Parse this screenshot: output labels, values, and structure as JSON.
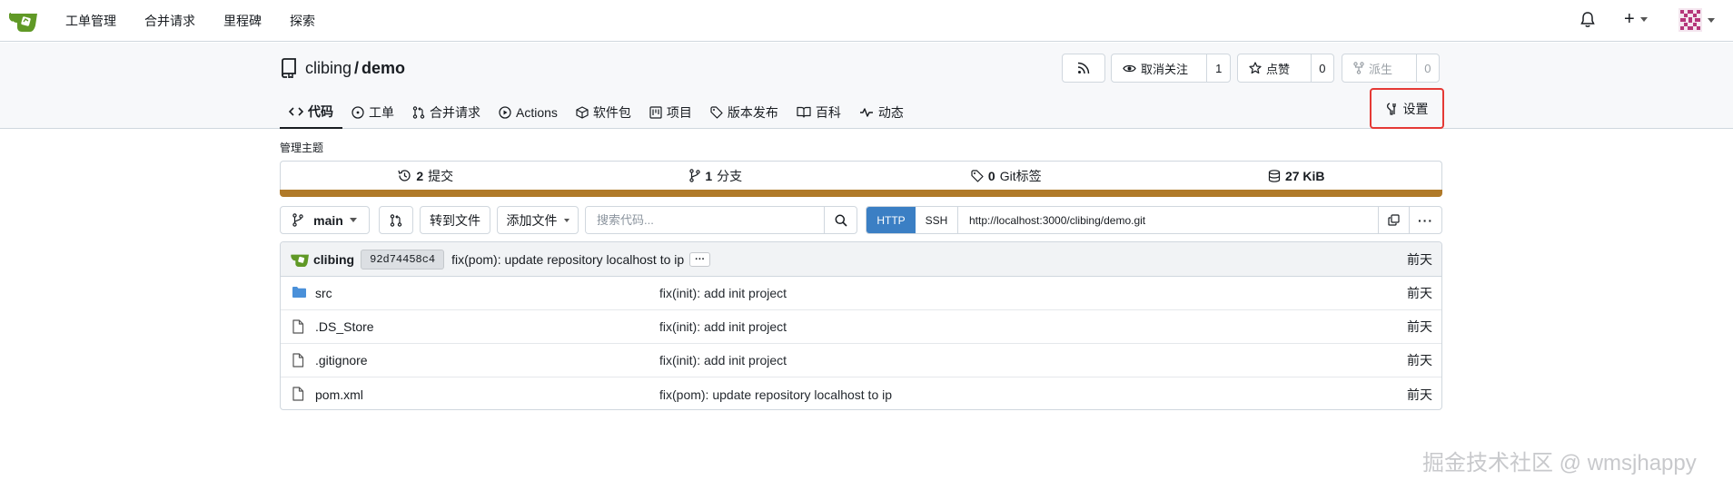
{
  "navbar": {
    "items": [
      "工单管理",
      "合并请求",
      "里程碑",
      "探索"
    ],
    "add_label": "+"
  },
  "repo": {
    "owner": "clibing",
    "separator": "/",
    "name": "demo",
    "unwatch_label": "取消关注",
    "watch_count": "1",
    "star_label": "点赞",
    "star_count": "0",
    "fork_label": "派生",
    "fork_count": "0"
  },
  "tabs": [
    {
      "label": "代码",
      "icon": "code-icon"
    },
    {
      "label": "工单",
      "icon": "issue-icon"
    },
    {
      "label": "合并请求",
      "icon": "pull-request-icon"
    },
    {
      "label": "Actions",
      "icon": "play-icon"
    },
    {
      "label": "软件包",
      "icon": "package-icon"
    },
    {
      "label": "项目",
      "icon": "project-icon"
    },
    {
      "label": "版本发布",
      "icon": "tag-icon"
    },
    {
      "label": "百科",
      "icon": "book-icon"
    },
    {
      "label": "动态",
      "icon": "pulse-icon"
    }
  ],
  "settings_label": "设置",
  "topics_label": "管理主题",
  "stats": {
    "commits_count": "2",
    "commits_label": "提交",
    "branches_count": "1",
    "branches_label": "分支",
    "tags_count": "0",
    "tags_label": "Git标签",
    "size_value": "27 KiB"
  },
  "accent_colors": {
    "lang_bar": "#b07a29",
    "http_active": "#3b7fc4",
    "settings_highlight": "#e53935"
  },
  "toolbar": {
    "branch": "main",
    "goto_file": "转到文件",
    "add_file": "添加文件",
    "search_placeholder": "搜索代码...",
    "http": "HTTP",
    "ssh": "SSH",
    "clone_url": "http://localhost:3000/clibing/demo.git"
  },
  "latest_commit": {
    "author": "clibing",
    "sha": "92d74458c4",
    "message": "fix(pom): update repository localhost to ip",
    "time": "前天"
  },
  "files": [
    {
      "name": "src",
      "type": "folder",
      "message": "fix(init): add init project",
      "time": "前天"
    },
    {
      "name": ".DS_Store",
      "type": "file",
      "message": "fix(init): add init project",
      "time": "前天"
    },
    {
      "name": ".gitignore",
      "type": "file",
      "message": "fix(init): add init project",
      "time": "前天"
    },
    {
      "name": "pom.xml",
      "type": "file",
      "message": "fix(pom): update repository localhost to ip",
      "time": "前天"
    }
  ],
  "watermark": "掘金技术社区 @ wmsjhappy"
}
